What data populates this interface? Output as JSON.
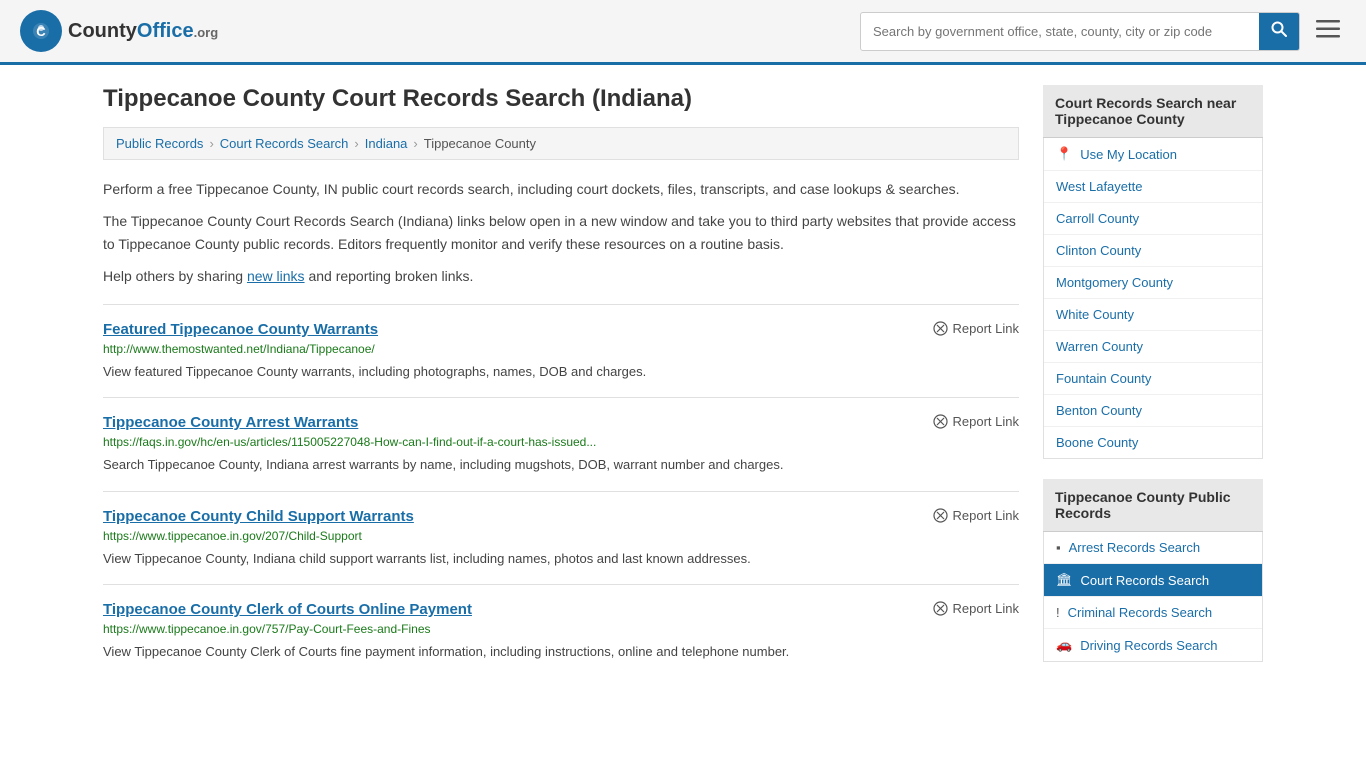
{
  "header": {
    "logo_text": "County",
    "logo_org": "Office",
    "logo_domain": ".org",
    "search_placeholder": "Search by government office, state, county, city or zip code"
  },
  "page": {
    "title": "Tippecanoe County Court Records Search (Indiana)"
  },
  "breadcrumb": {
    "items": [
      "Public Records",
      "Court Records Search",
      "Indiana",
      "Tippecanoe County"
    ]
  },
  "description": {
    "para1": "Perform a free Tippecanoe County, IN public court records search, including court dockets, files, transcripts, and case lookups & searches.",
    "para2": "The Tippecanoe County Court Records Search (Indiana) links below open in a new window and take you to third party websites that provide access to Tippecanoe County public records. Editors frequently monitor and verify these resources on a routine basis.",
    "para3_pre": "Help others by sharing ",
    "para3_link": "new links",
    "para3_post": " and reporting broken links."
  },
  "results": [
    {
      "title": "Featured Tippecanoe County Warrants",
      "url": "http://www.themostwanted.net/Indiana/Tippecanoe/",
      "desc": "View featured Tippecanoe County warrants, including photographs, names, DOB and charges.",
      "report": "Report Link"
    },
    {
      "title": "Tippecanoe County Arrest Warrants",
      "url": "https://faqs.in.gov/hc/en-us/articles/115005227048-How-can-I-find-out-if-a-court-has-issued...",
      "desc": "Search Tippecanoe County, Indiana arrest warrants by name, including mugshots, DOB, warrant number and charges.",
      "report": "Report Link"
    },
    {
      "title": "Tippecanoe County Child Support Warrants",
      "url": "https://www.tippecanoe.in.gov/207/Child-Support",
      "desc": "View Tippecanoe County, Indiana child support warrants list, including names, photos and last known addresses.",
      "report": "Report Link"
    },
    {
      "title": "Tippecanoe County Clerk of Courts Online Payment",
      "url": "https://www.tippecanoe.in.gov/757/Pay-Court-Fees-and-Fines",
      "desc": "View Tippecanoe County Clerk of Courts fine payment information, including instructions, online and telephone number.",
      "report": "Report Link"
    }
  ],
  "sidebar": {
    "nearby_header": "Court Records Search near Tippecanoe County",
    "use_location": "Use My Location",
    "nearby_links": [
      "West Lafayette",
      "Carroll County",
      "Clinton County",
      "Montgomery County",
      "White County",
      "Warren County",
      "Fountain County",
      "Benton County",
      "Boone County"
    ],
    "records_header": "Tippecanoe County Public Records",
    "records_links": [
      {
        "label": "Arrest Records Search",
        "icon": "▪",
        "active": false
      },
      {
        "label": "Court Records Search",
        "icon": "🏛",
        "active": true
      },
      {
        "label": "Criminal Records Search",
        "icon": "!",
        "active": false
      },
      {
        "label": "Driving Records Search",
        "icon": "🔑",
        "active": false
      }
    ]
  }
}
